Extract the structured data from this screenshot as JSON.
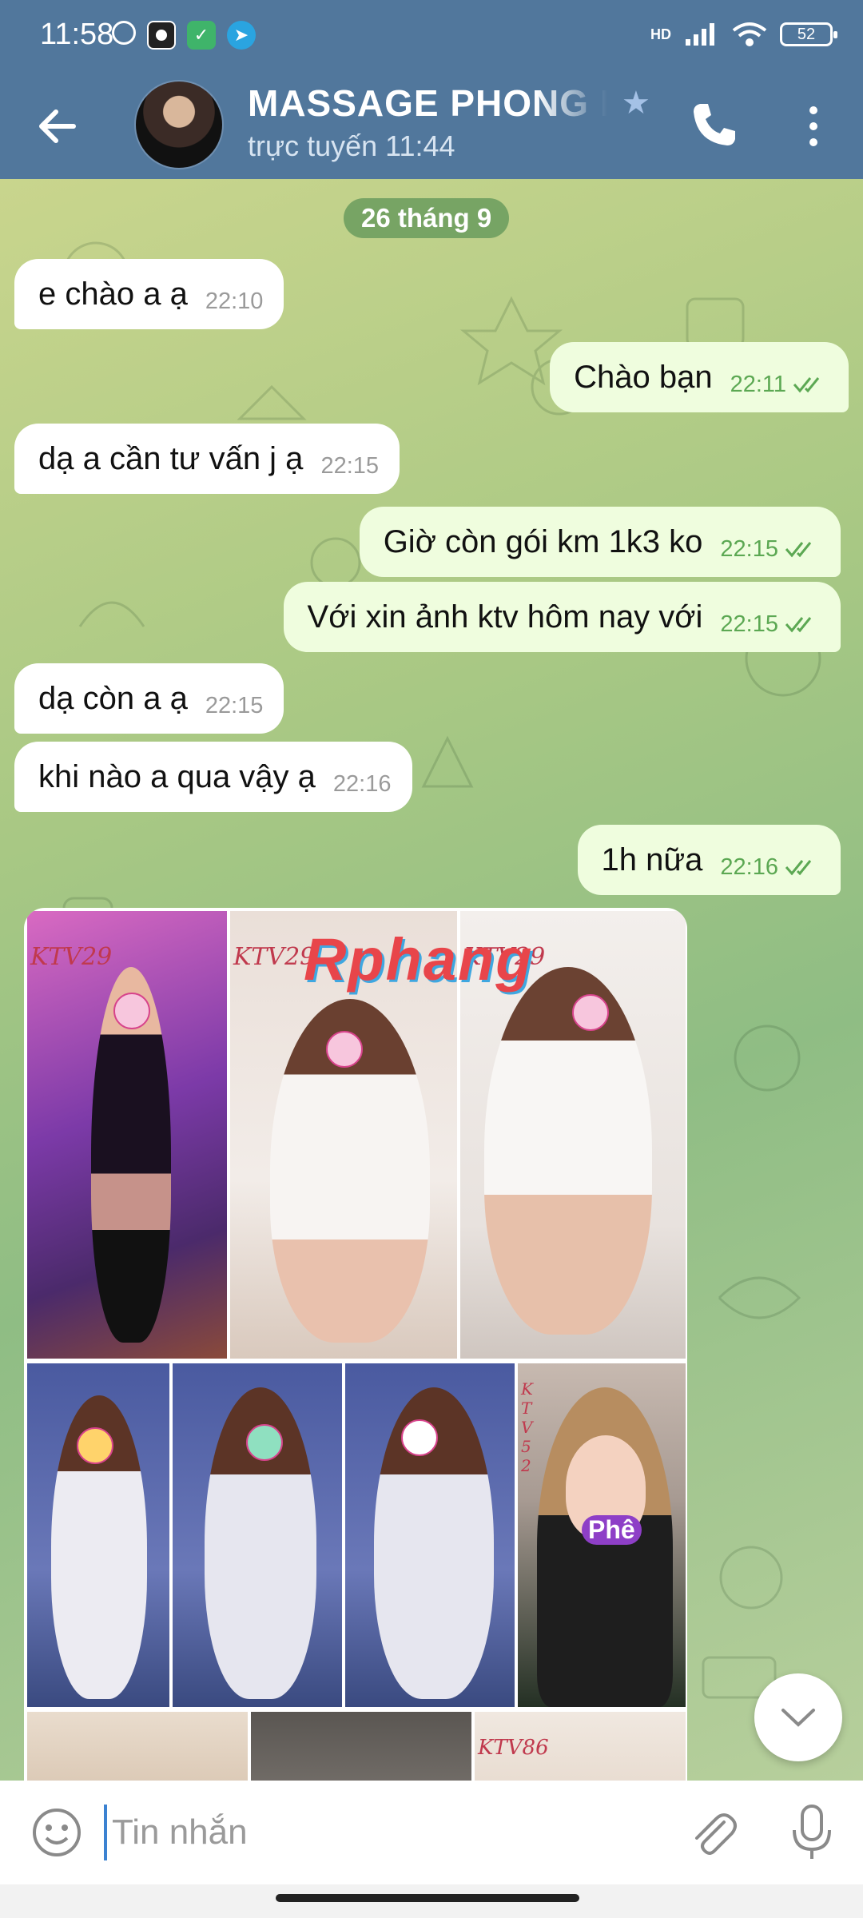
{
  "status_bar": {
    "time": "11:58",
    "network": "HD",
    "battery": "52"
  },
  "header": {
    "title": "MASSAGE PHONG N",
    "subtitle": "trực tuyến 11:44"
  },
  "chat": {
    "date_chip": "26 tháng 9",
    "messages": [
      {
        "dir": "in",
        "text": "e chào a ạ",
        "time": "22:10"
      },
      {
        "dir": "out",
        "text": "Chào bạn",
        "time": "22:11",
        "read": true
      },
      {
        "dir": "in",
        "text": "dạ a cần tư vấn j ạ",
        "time": "22:15"
      },
      {
        "dir": "out",
        "text": "Giờ còn gói km 1k3 ko",
        "time": "22:15",
        "read": true
      },
      {
        "dir": "out",
        "text": "Với xin ảnh ktv hôm nay với",
        "time": "22:15",
        "read": true
      },
      {
        "dir": "in",
        "text": "dạ còn a ạ",
        "time": "22:15"
      },
      {
        "dir": "in",
        "text": "khi nào a qua vậy ạ",
        "time": "22:16"
      },
      {
        "dir": "out",
        "text": "1h nữa",
        "time": "22:16",
        "read": true
      }
    ],
    "album": {
      "watermark": "Rphang",
      "labels": [
        "KTV29",
        "KTV29",
        "KTV29",
        "K T V 52",
        "KTV86"
      ],
      "sticker_text": "Phê"
    }
  },
  "input": {
    "placeholder": "Tin nhắn"
  },
  "colors": {
    "header": "#51779c",
    "outgoing": "#effdde",
    "incoming": "#ffffff",
    "check": "#5ca853"
  }
}
